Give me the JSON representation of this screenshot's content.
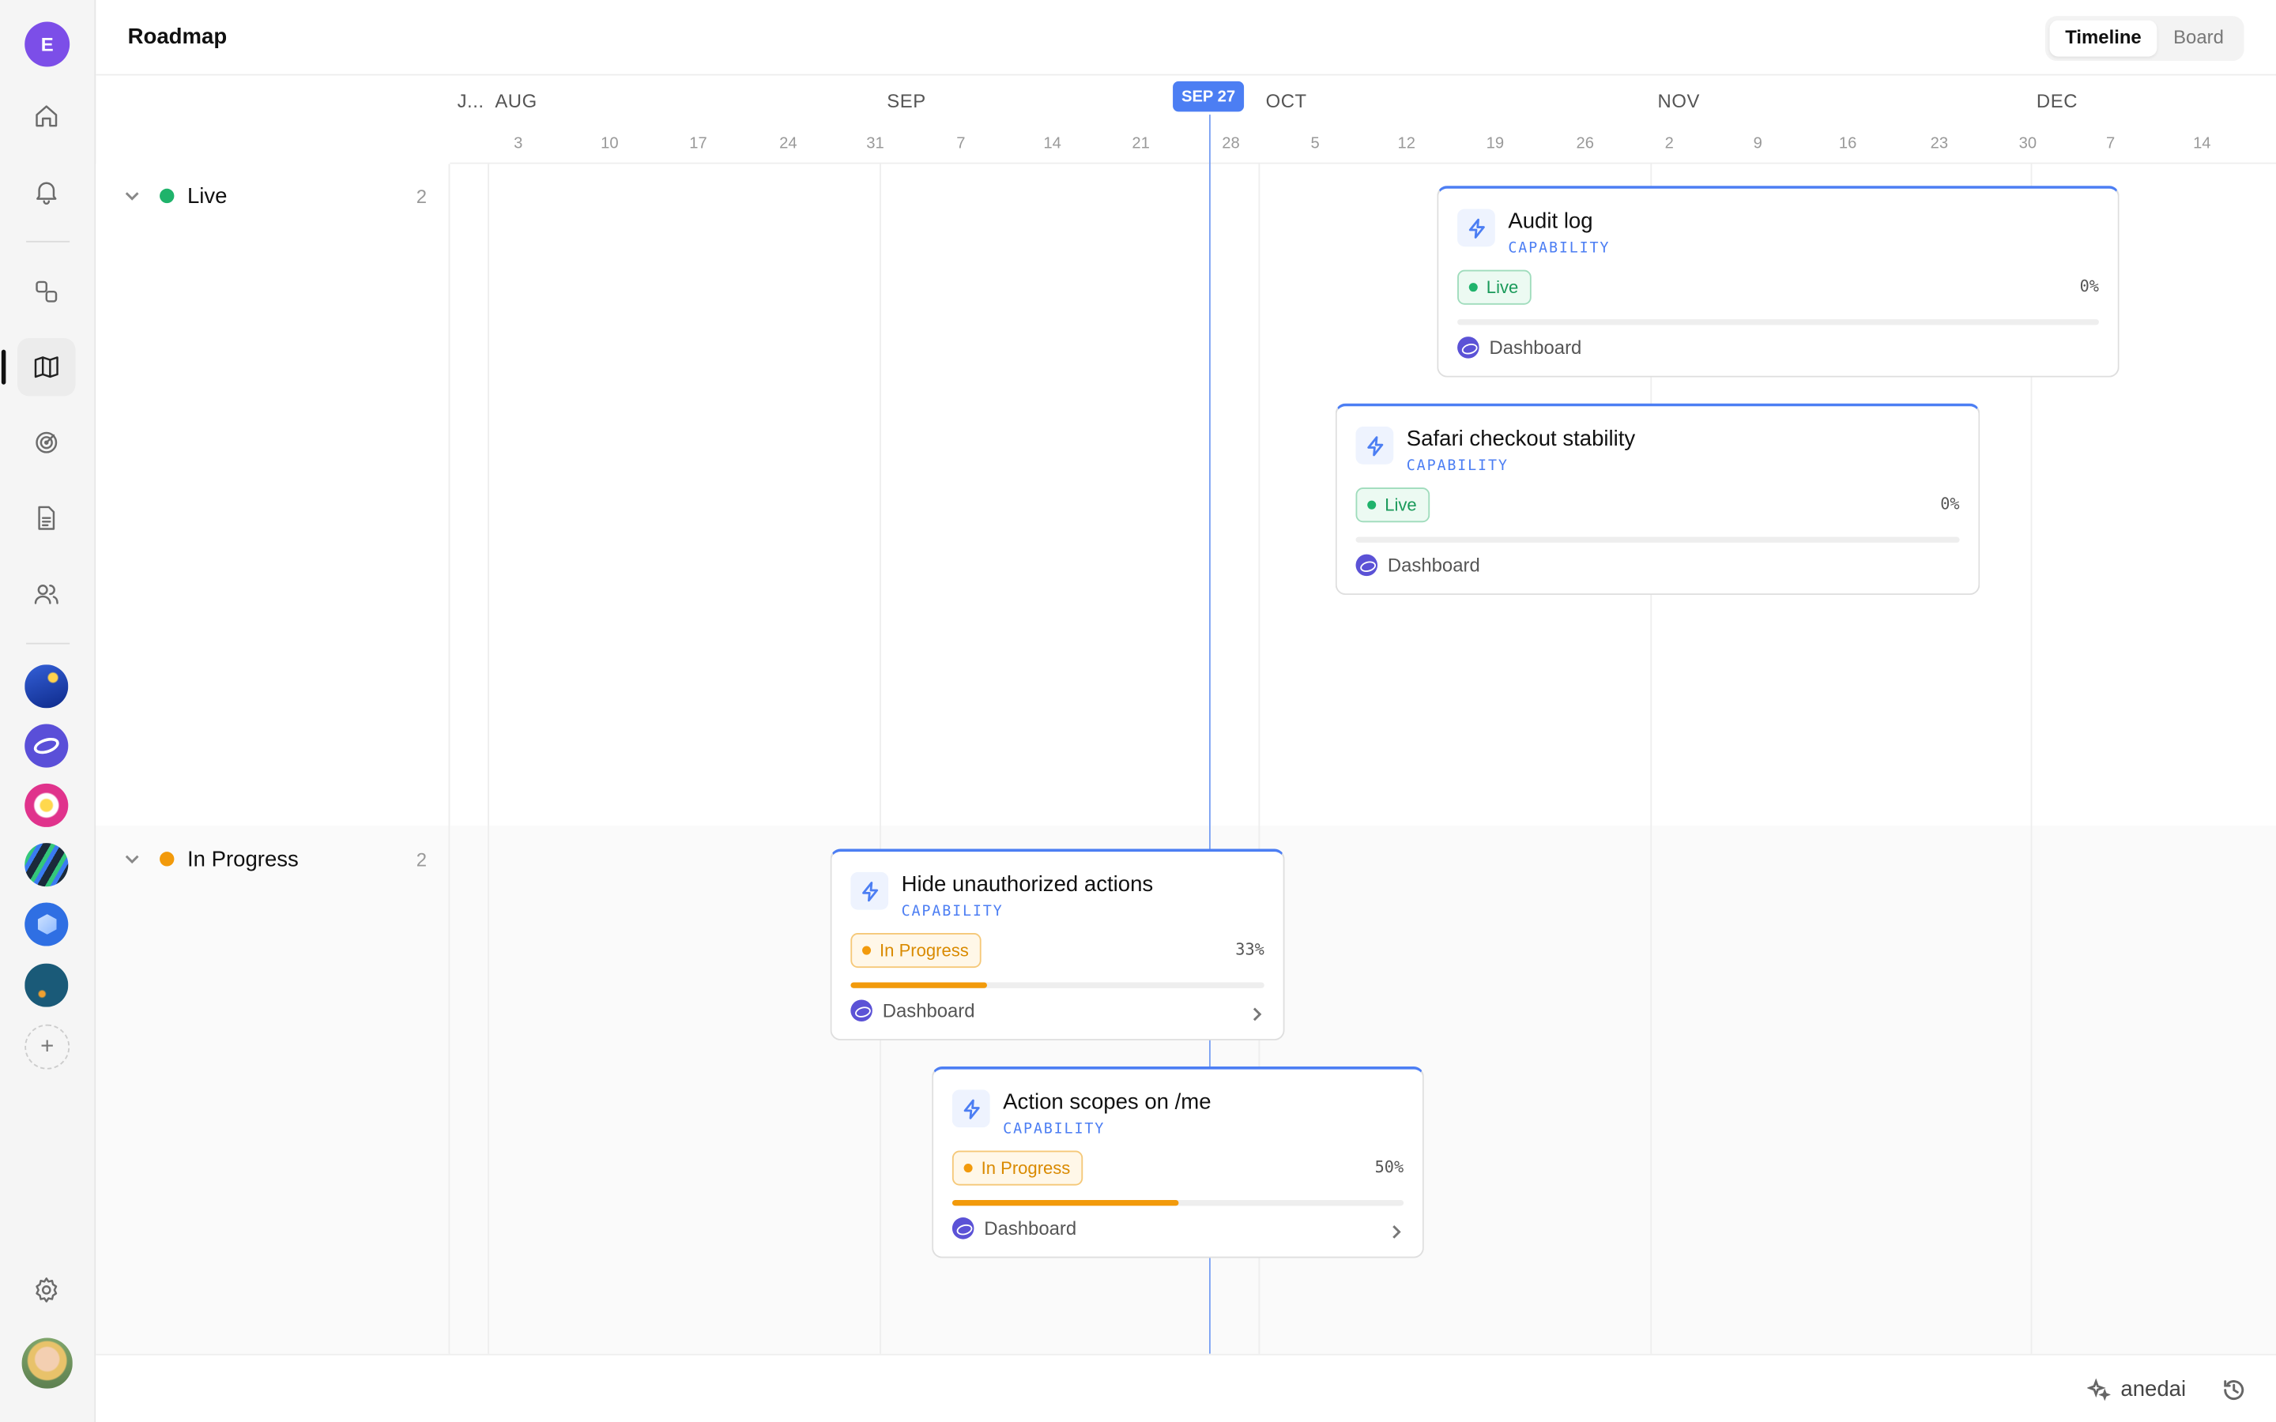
{
  "sidebar": {
    "user_initial": "E",
    "nav_icons": [
      "home-icon",
      "bell-icon",
      "shapes-icon",
      "map-icon",
      "target-icon",
      "document-icon",
      "users-icon"
    ],
    "workspaces": [
      "workspace-night",
      "workspace-planet",
      "workspace-flower",
      "workspace-stripes",
      "workspace-cube",
      "workspace-ocean"
    ],
    "add_label": "+"
  },
  "header": {
    "title": "Roadmap",
    "views": [
      "Timeline",
      "Board"
    ],
    "active_view": "Timeline"
  },
  "timeline": {
    "months": [
      "J...",
      "AUG",
      "SEP",
      "OCT",
      "NOV",
      "DEC"
    ],
    "days": [
      "3",
      "10",
      "17",
      "24",
      "31",
      "7",
      "14",
      "21",
      "28",
      "5",
      "12",
      "19",
      "26",
      "2",
      "9",
      "16",
      "23",
      "30",
      "7",
      "14"
    ],
    "today_label": "SEP 27"
  },
  "groups": [
    {
      "name": "Live",
      "count": "2",
      "color": "#1fb36b"
    },
    {
      "name": "In Progress",
      "count": "2",
      "color": "#f29a0b"
    }
  ],
  "cards": [
    {
      "title": "Audit log",
      "type": "CAPABILITY",
      "status": "Live",
      "percent": "0%",
      "progress": 0,
      "product": "Dashboard"
    },
    {
      "title": "Safari checkout stability",
      "type": "CAPABILITY",
      "status": "Live",
      "percent": "0%",
      "progress": 0,
      "product": "Dashboard"
    },
    {
      "title": "Hide unauthorized actions",
      "type": "CAPABILITY",
      "status": "In Progress",
      "percent": "33%",
      "progress": 0.33,
      "product": "Dashboard"
    },
    {
      "title": "Action scopes on /me",
      "type": "CAPABILITY",
      "status": "In Progress",
      "percent": "50%",
      "progress": 0.5,
      "product": "Dashboard"
    }
  ],
  "footer": {
    "brand": "anedai"
  },
  "colors": {
    "accent": "#4c7ef3",
    "live": "#1fb36b",
    "in_progress": "#f29a0b"
  }
}
